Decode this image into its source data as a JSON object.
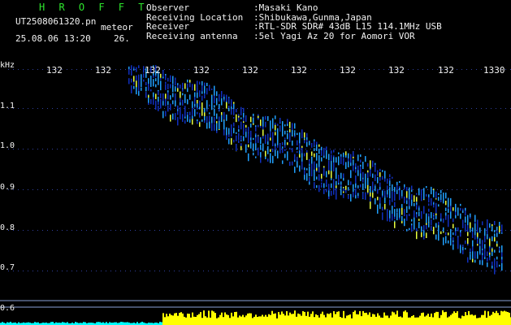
{
  "header": {
    "logo": "H R O F F T",
    "filename": "UT2508061320.pn",
    "tag": "meteor",
    "date_time": "25.08.06 13:20",
    "aux_value": "26.",
    "fields": [
      {
        "key": "Observer",
        "value": ":Masaki Kano"
      },
      {
        "key": "Receiving Location",
        "value": ":Shibukawa,Gunma,Japan"
      },
      {
        "key": "Receiver",
        "value": ":RTL-SDR SDR# 43dB L15 114.1MHz USB"
      },
      {
        "key": "Receiving antenna",
        "value": ":5el Yagi Az 20 for Aomori VOR"
      }
    ]
  },
  "spectrogram": {
    "y_unit": "kHz",
    "x_ticks": [
      "132",
      "132",
      "132",
      "132",
      "132",
      "132",
      "132",
      "132",
      "132",
      "1330"
    ],
    "y_ticks": [
      "1.1",
      "1.0",
      "0.9",
      "0.8",
      "0.7",
      "0.6"
    ],
    "colors": {
      "background": "#000000",
      "signal_low": "#1030c0",
      "signal_mid": "#20a0ff",
      "signal_high": "#e8ff40",
      "baseline_bar": "#ffff00",
      "baseline_low": "#00ffff",
      "separator": "#8aa0d8"
    }
  }
}
